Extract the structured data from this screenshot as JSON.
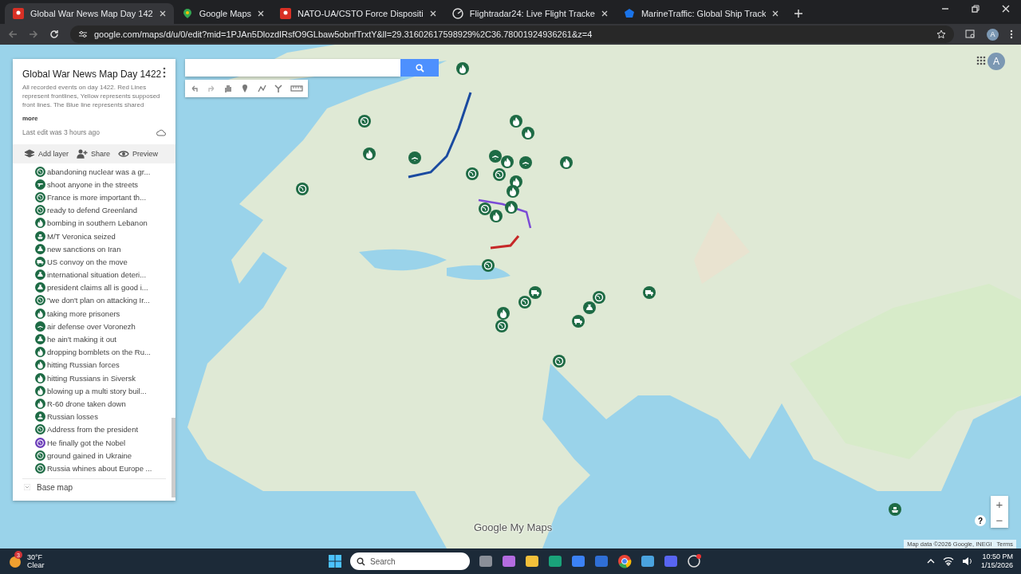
{
  "browser": {
    "tabs": [
      {
        "title": "Global War News Map Day 142",
        "kind": "mymaps",
        "selected": true
      },
      {
        "title": "Google Maps",
        "kind": "maps",
        "selected": false
      },
      {
        "title": "NATO-UA/CSTO Force Dispositi",
        "kind": "mymaps",
        "selected": false
      },
      {
        "title": "Flightradar24: Live Flight Tracke",
        "kind": "radar",
        "selected": false
      },
      {
        "title": "MarineTraffic: Global Ship Track",
        "kind": "shield",
        "selected": false
      }
    ],
    "url": "google.com/maps/d/u/0/edit?mid=1PJAn5DlozdIRsfO9GLbaw5obnfTrxtY&ll=29.31602617598929%2C36.78001924936261&z=4",
    "profile": "A"
  },
  "sidebar": {
    "title": "Global War News Map Day 1422",
    "description": "All recorded events on day 1422. Red Lines represent frontlines, Yellow represents supposed front lines. The Blue line represents shared",
    "more": "more",
    "last_edit": "Last edit was 3 hours ago",
    "actions": [
      {
        "label": "Add layer",
        "kind": "layers"
      },
      {
        "label": "Share",
        "kind": "share"
      },
      {
        "label": "Preview",
        "kind": "eye"
      }
    ],
    "items": [
      {
        "label": "abandoning nuclear was a gr...",
        "kind": "globe",
        "color": "#1e6b45"
      },
      {
        "label": "shoot anyone in the streets",
        "kind": "weapon",
        "color": "#1e6b45"
      },
      {
        "label": "France is more important th...",
        "kind": "globe",
        "color": "#1e6b45"
      },
      {
        "label": "ready to defend Greenland",
        "kind": "globe",
        "color": "#1e6b45"
      },
      {
        "label": "bombing in southern Lebanon",
        "kind": "flame",
        "color": "#1e6b45"
      },
      {
        "label": "M/T Veronica seized",
        "kind": "ship",
        "color": "#1e6b45"
      },
      {
        "label": "new sanctions on Iran",
        "kind": "bag",
        "color": "#1e6b45"
      },
      {
        "label": "US convoy on the move",
        "kind": "truck",
        "color": "#1e6b45"
      },
      {
        "label": "international situation deteri...",
        "kind": "bag",
        "color": "#1e6b45"
      },
      {
        "label": "president claims all is good i...",
        "kind": "bag",
        "color": "#1e6b45"
      },
      {
        "label": "\"we don't plan on attacking Ir...",
        "kind": "globe",
        "color": "#1e6b45"
      },
      {
        "label": "taking more prisoners",
        "kind": "flame",
        "color": "#1e6b45"
      },
      {
        "label": "air defense over Voronezh",
        "kind": "plane",
        "color": "#1e6b45"
      },
      {
        "label": "he ain't making it out",
        "kind": "bag",
        "color": "#1e6b45"
      },
      {
        "label": "dropping bomblets on the Ru...",
        "kind": "flame",
        "color": "#1e6b45"
      },
      {
        "label": "hitting Russian forces",
        "kind": "flame",
        "color": "#1e6b45"
      },
      {
        "label": "hitting Russians in Siversk",
        "kind": "flame",
        "color": "#1e6b45"
      },
      {
        "label": "blowing up a multi story buil...",
        "kind": "flame",
        "color": "#1e6b45"
      },
      {
        "label": "R-60 drone taken down",
        "kind": "flame",
        "color": "#1e6b45"
      },
      {
        "label": "Russian losses",
        "kind": "person",
        "color": "#1e6b45"
      },
      {
        "label": "Address from the president",
        "kind": "globe",
        "color": "#1e6b45"
      },
      {
        "label": "He finally got the Nobel",
        "kind": "globe",
        "color": "#6a3bb8"
      },
      {
        "label": "ground gained in Ukraine",
        "kind": "globe",
        "color": "#1e6b45"
      },
      {
        "label": "Russia whines about Europe ...",
        "kind": "globe",
        "color": "#1e6b45"
      }
    ],
    "base_map": "Base map"
  },
  "map": {
    "account": "A",
    "zoom_in": "+",
    "zoom_out": "−",
    "help": "?",
    "logo": "Google My Maps",
    "attribution": "Map data ©2026 Google, INEGI",
    "terms": "Terms"
  },
  "taskbar": {
    "temperature": "30°F",
    "condition": "Clear",
    "weather_badge": "3",
    "search_placeholder": "Search",
    "time": "10:50 PM",
    "date": "1/15/2026"
  }
}
